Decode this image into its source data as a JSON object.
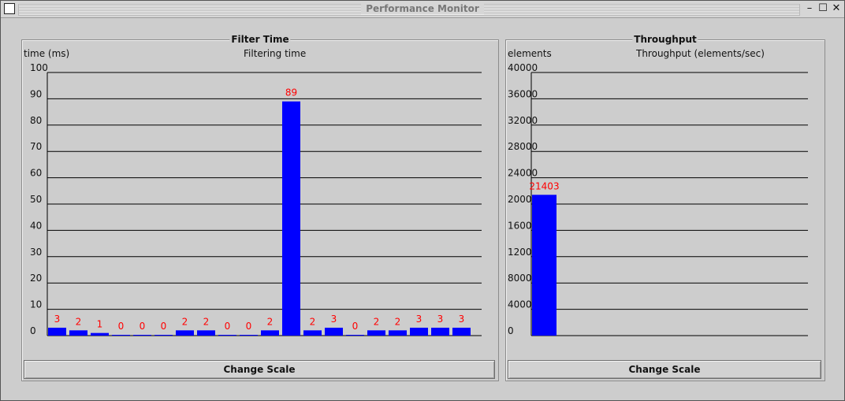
{
  "window": {
    "title": "Performance Monitor",
    "minimize_glyph": "–",
    "maximize_glyph": "☐",
    "close_glyph": "✕"
  },
  "filter_panel": {
    "title": "Filter Time",
    "y_unit": "time (ms)",
    "subtitle": "Filtering time",
    "button_label": "Change Scale"
  },
  "throughput_panel": {
    "title": "Throughput",
    "y_unit": "elements",
    "subtitle": "Throughput (elements/sec)",
    "button_label": "Change Scale"
  },
  "colors": {
    "bar": "#0000ff",
    "value_label": "#ff0000",
    "grid": "#000000"
  },
  "chart_data": [
    {
      "type": "bar",
      "title": "Filtering time",
      "ylabel": "time (ms)",
      "ylim": [
        0,
        100
      ],
      "yticks": [
        0,
        10,
        20,
        30,
        40,
        50,
        60,
        70,
        80,
        90,
        100
      ],
      "values": [
        3,
        2,
        1,
        0,
        0,
        0,
        2,
        2,
        0,
        0,
        2,
        89,
        2,
        3,
        0,
        2,
        2,
        3,
        3,
        3
      ],
      "labels": [
        "3",
        "2",
        "1",
        "0",
        "0",
        "0",
        "2",
        "2",
        "0",
        "0",
        "2",
        "89",
        "2",
        "3",
        "0",
        "2",
        "2",
        "3",
        "3",
        "3"
      ],
      "grid": true
    },
    {
      "type": "bar",
      "title": "Throughput (elements/sec)",
      "ylabel": "elements",
      "ylim": [
        0,
        40000
      ],
      "yticks": [
        "0",
        "4000",
        "8000",
        "1200",
        "1600",
        "2000",
        "24000",
        "28000",
        "32000",
        "36000",
        "40000"
      ],
      "values": [
        21403
      ],
      "labels": [
        "21403"
      ],
      "grid": true
    }
  ]
}
